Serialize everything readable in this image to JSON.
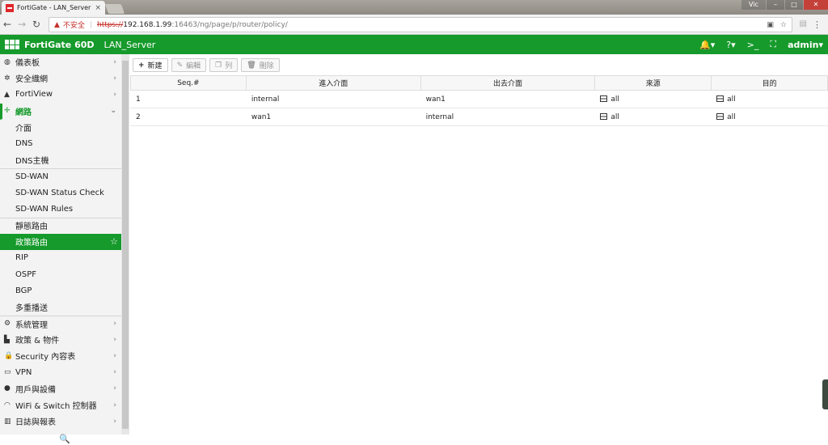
{
  "browser": {
    "tab_title": "FortiGate - LAN_Server",
    "tab_close": "×",
    "window_user": "Vic",
    "window_minimize": "–",
    "window_maximize": "□",
    "window_close": "✕",
    "not_secure": "不安全",
    "url_scheme": "https://",
    "url_host": "192.168.1.99",
    "url_path": ":16463/ng/page/p/router/policy/"
  },
  "header": {
    "model": "FortiGate 60D",
    "hostname": "LAN_Server",
    "user": "admin"
  },
  "sidebar": {
    "items": [
      {
        "icon": "dashboard-icon",
        "glyph": "◍",
        "label": "儀表板",
        "chevron": "›"
      },
      {
        "icon": "security-fabric-icon",
        "glyph": "✲",
        "label": "安全織網",
        "chevron": "›"
      },
      {
        "icon": "fortiview-icon",
        "glyph": "▲",
        "label": "FortiView",
        "chevron": "›"
      },
      {
        "icon": "network-icon",
        "glyph": "✛",
        "label": "網路",
        "chevron": "⌄"
      }
    ],
    "network_sub": [
      {
        "label": "介面"
      },
      {
        "label": "DNS"
      },
      {
        "label": "DNS主機"
      },
      {
        "label": "SD-WAN"
      },
      {
        "label": "SD-WAN Status Check"
      },
      {
        "label": "SD-WAN Rules"
      },
      {
        "label": "靜態路由"
      },
      {
        "label": "政策路由"
      },
      {
        "label": "RIP"
      },
      {
        "label": "OSPF"
      },
      {
        "label": "BGP"
      },
      {
        "label": "多重播送"
      }
    ],
    "items_after": [
      {
        "icon": "system-icon",
        "glyph": "⚙",
        "label": "系統管理",
        "chevron": "›"
      },
      {
        "icon": "policy-objects-icon",
        "glyph": "▙",
        "label": "政策 & 物件",
        "chevron": "›"
      },
      {
        "icon": "security-profiles-icon",
        "glyph": "🔒",
        "label": "Security 內容表",
        "chevron": "›"
      },
      {
        "icon": "vpn-icon",
        "glyph": "▭",
        "label": "VPN",
        "chevron": "›"
      },
      {
        "icon": "user-device-icon",
        "glyph": "●",
        "label": "用戶與設備",
        "chevron": "›"
      },
      {
        "icon": "wifi-switch-icon",
        "glyph": "◠",
        "label": "WiFi & Switch 控制器",
        "chevron": "›"
      },
      {
        "icon": "log-report-icon",
        "glyph": "▥",
        "label": "日誌與報表",
        "chevron": "›"
      }
    ]
  },
  "toolbar": {
    "new": "新建",
    "edit": "編輯",
    "clone": "列",
    "delete": "刪除"
  },
  "table": {
    "columns": [
      "Seq.#",
      "進入介面",
      "出去介面",
      "來源",
      "目的"
    ],
    "rows": [
      {
        "seq": "1",
        "incoming": "internal",
        "outgoing": "wan1",
        "source": "all",
        "destination": "all"
      },
      {
        "seq": "2",
        "incoming": "wan1",
        "outgoing": "internal",
        "source": "all",
        "destination": "all"
      }
    ]
  },
  "colors": {
    "fortinet_green": "#159a2b",
    "not_secure_red": "#c4302b"
  }
}
